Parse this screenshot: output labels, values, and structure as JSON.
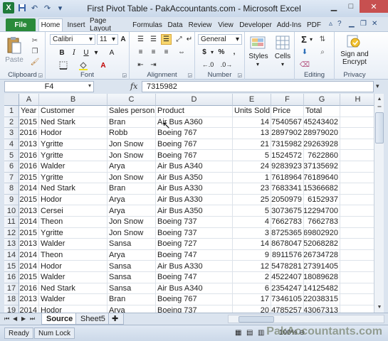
{
  "window": {
    "title": "First Pivot Table - PakAccountants.com  -  Microsoft Excel",
    "app_logo": "X"
  },
  "ribbon_tabs": [
    "File",
    "Home",
    "Insert",
    "Page Layout",
    "Formulas",
    "Data",
    "Review",
    "View",
    "Developer",
    "Add-Ins",
    "PDF"
  ],
  "ribbon": {
    "clipboard": {
      "label": "Clipboard",
      "paste": "Paste"
    },
    "font": {
      "label": "Font",
      "name": "Calibri",
      "size": "11",
      "bold": "B",
      "italic": "I",
      "underline": "U",
      "grow": "A",
      "shrink": "A",
      "font_color": "A"
    },
    "alignment": {
      "label": "Alignment"
    },
    "number": {
      "label": "Number",
      "format": "General",
      "currency": "$",
      "percent": "%",
      "comma": ","
    },
    "styles": {
      "label": "Styles"
    },
    "cells": {
      "label": "Cells"
    },
    "editing": {
      "label": "Editing",
      "sum": "Σ"
    },
    "privacy": {
      "label": "Privacy",
      "sign": "Sign and",
      "encrypt": "Encrypt"
    }
  },
  "formula_bar": {
    "name_box": "F4",
    "fx": "fx",
    "value": "7315982"
  },
  "columns": [
    "A",
    "B",
    "C",
    "D",
    "E",
    "F",
    "G",
    "H"
  ],
  "rows": [
    [
      "Year",
      "Customer",
      "Sales person",
      "Product",
      "Units Sold",
      "Price",
      "Total"
    ],
    [
      "2015",
      "Ned Stark",
      "Bran",
      "Air Bus A360",
      "14",
      "7540567",
      "45243402"
    ],
    [
      "2016",
      "Hodor",
      "Robb",
      "Boeing 767",
      "13",
      "2897902",
      "28979020"
    ],
    [
      "2013",
      "Ygritte",
      "Jon Snow",
      "Boeing 767",
      "21",
      "7315982",
      "29263928"
    ],
    [
      "2016",
      "Ygritte",
      "Jon Snow",
      "Boeing 767",
      "5",
      "1524572",
      "7622860"
    ],
    [
      "2016",
      "Walder",
      "Arya",
      "Air Bus A340",
      "24",
      "9283923",
      "37135692"
    ],
    [
      "2015",
      "Ygritte",
      "Jon Snow",
      "Air Bus A350",
      "1",
      "7618964",
      "76189640"
    ],
    [
      "2014",
      "Ned Stark",
      "Bran",
      "Air Bus A330",
      "23",
      "7683341",
      "15366682"
    ],
    [
      "2015",
      "Hodor",
      "Arya",
      "Air Bus A330",
      "25",
      "2050979",
      "6152937"
    ],
    [
      "2013",
      "Cersei",
      "Arya",
      "Air Bus A350",
      "5",
      "3073675",
      "12294700"
    ],
    [
      "2014",
      "Theon",
      "Jon Snow",
      "Boeing 737",
      "4",
      "7662783",
      "7662783"
    ],
    [
      "2015",
      "Ygritte",
      "Jon Snow",
      "Boeing 737",
      "3",
      "8725365",
      "69802920"
    ],
    [
      "2013",
      "Walder",
      "Sansa",
      "Boeing 727",
      "14",
      "8678047",
      "52068282"
    ],
    [
      "2014",
      "Theon",
      "Arya",
      "Boeing 747",
      "9",
      "8911576",
      "26734728"
    ],
    [
      "2014",
      "Hodor",
      "Sansa",
      "Air Bus A330",
      "12",
      "5478281",
      "27391405"
    ],
    [
      "2015",
      "Walder",
      "Sansa",
      "Boeing 747",
      "2",
      "4522407",
      "18089628"
    ],
    [
      "2016",
      "Ned Stark",
      "Sansa",
      "Air Bus A340",
      "6",
      "2354247",
      "14125482"
    ],
    [
      "2013",
      "Walder",
      "Bran",
      "Boeing 767",
      "17",
      "7346105",
      "22038315"
    ],
    [
      "2014",
      "Hodor",
      "Arya",
      "Boeing 737",
      "20",
      "4785257",
      "43067313"
    ]
  ],
  "sheet_tabs": [
    "Source",
    "Sheet5"
  ],
  "status": {
    "ready": "Ready",
    "numlock": "Num Lock",
    "zoom": "100%"
  },
  "watermark": "PakAccountants.com"
}
